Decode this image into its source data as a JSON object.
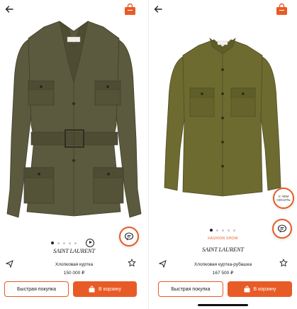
{
  "colors": {
    "accent": "#e85b26",
    "jacket_left": "#5b5a3e",
    "jacket_right": "#6d6b30"
  },
  "left_card": {
    "brand": "SAINT LAURENT",
    "name": "Хлопковая куртка",
    "price": "150 000 ₽",
    "quick_buy_label": "Быстрая покупка",
    "cart_label": "В корзину",
    "gallery": {
      "count": 5,
      "active": 1
    }
  },
  "right_card": {
    "badge": "FASHION SHOW",
    "brand": "SAINT LAURENT",
    "name": "Хлопковая куртка-рубашка",
    "price": "167 500 ₽",
    "quick_buy_label": "Быстрая покупка",
    "cart_label": "В корзину",
    "wear_with_label": "С ЧЕМ НОСИТЬ",
    "gallery": {
      "count": 5,
      "active": 1
    }
  },
  "icons": [
    "back-arrow-icon",
    "shopping-bag-icon",
    "play-icon",
    "chat-icon",
    "share-icon",
    "star-icon"
  ]
}
